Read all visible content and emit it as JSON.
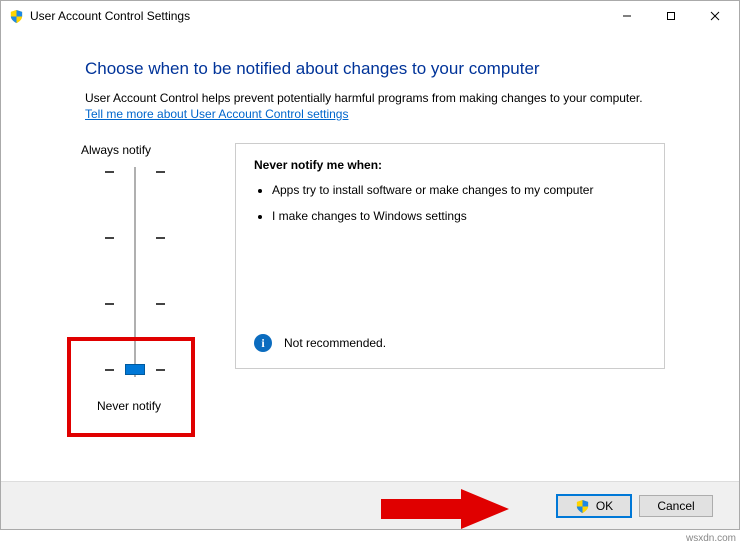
{
  "titlebar": {
    "title": "User Account Control Settings"
  },
  "heading": "Choose when to be notified about changes to your computer",
  "subtext": "User Account Control helps prevent potentially harmful programs from making changes to your computer.",
  "link_text": "Tell me more about User Account Control settings",
  "slider": {
    "top_label": "Always notify",
    "bottom_label": "Never notify",
    "position": 3,
    "levels": 4
  },
  "description": {
    "title": "Never notify me when:",
    "bullets": [
      "Apps try to install software or make changes to my computer",
      "I make changes to Windows settings"
    ],
    "footer_text": "Not recommended."
  },
  "buttons": {
    "ok": "OK",
    "cancel": "Cancel"
  },
  "watermark": "wsxdn.com"
}
